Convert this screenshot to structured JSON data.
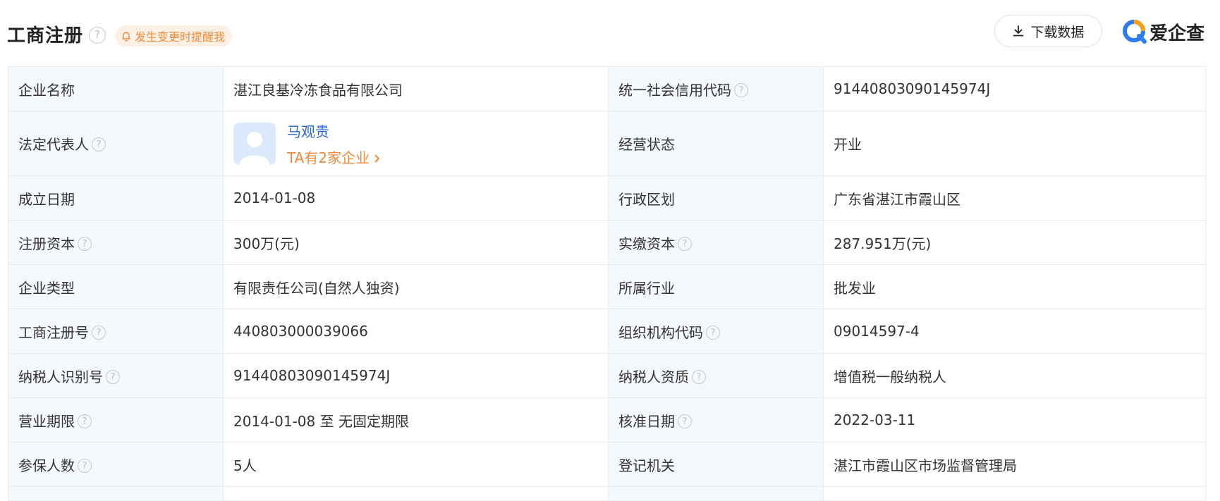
{
  "header": {
    "title": "工商注册",
    "remind_label": "发生变更时提醒我",
    "download_label": "下载数据",
    "brand": "爱企查"
  },
  "table": {
    "rows": [
      {
        "l1": "企业名称",
        "v1": "湛江良基冷冻食品有限公司",
        "l2": "统一社会信用代码",
        "v2": "91440803090145974J"
      },
      {
        "l1": "法定代表人",
        "person_name": "马观贵",
        "person_link": "TA有2家企业",
        "l2": "经营状态",
        "v2": "开业"
      },
      {
        "l1": "成立日期",
        "v1": "2014-01-08",
        "l2": "行政区划",
        "v2": "广东省湛江市霞山区"
      },
      {
        "l1": "注册资本",
        "v1": "300万(元)",
        "l2": "实缴资本",
        "v2": "287.951万(元)"
      },
      {
        "l1": "企业类型",
        "v1": "有限责任公司(自然人独资)",
        "l2": "所属行业",
        "v2": "批发业"
      },
      {
        "l1": "工商注册号",
        "v1": "440803000039066",
        "l2": "组织机构代码",
        "v2": "09014597-4"
      },
      {
        "l1": "纳税人识别号",
        "v1": "91440803090145974J",
        "l2": "纳税人资质",
        "v2": "增值税一般纳税人"
      },
      {
        "l1": "营业期限",
        "v1": "2014-01-08 至 无固定期限",
        "l2": "核准日期",
        "v2": "2022-03-11"
      },
      {
        "l1": "参保人数",
        "v1": "5人",
        "l2": "登记机关",
        "v2": "湛江市霞山区市场监督管理局"
      }
    ]
  },
  "icons": {
    "help": "question-circle-icon",
    "bell": "bell-icon",
    "download": "download-icon",
    "brand_logo": "aiqicha-logo-icon",
    "chevron": "chevron-right-icon"
  },
  "colors": {
    "accent_orange": "#f08a3c",
    "link_blue": "#2a66d8",
    "label_bg": "#f5f8fc",
    "border": "#e8ebf0"
  }
}
